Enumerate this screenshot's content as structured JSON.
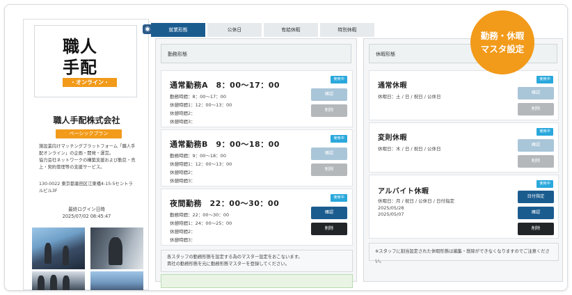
{
  "profile": {
    "logo_line1": "職人",
    "logo_line2": "手配",
    "logo_band": "・オンライン・",
    "company_name": "職人手配株式会社",
    "plan_label": "ベーシックプラン",
    "description": [
      "施設業向けマッチングプラットフォーム「職人手",
      "配オンライン」の企画・開発・運営。",
      "協力会社ネットワークの構築支援および勤怠・売",
      "上・契約管理等の支援サービス。"
    ],
    "address": [
      "130-0022 東京都墨田区江東橋4-15-5セントラ",
      "ルビル3F"
    ],
    "last_login_label": "最終ログイン日時",
    "last_login_value": "2025/07/02 08:45:47",
    "camera_icon": "camera-icon"
  },
  "tabs": [
    {
      "label": "就業形態",
      "active": true
    },
    {
      "label": "公休日",
      "active": false
    },
    {
      "label": "有給休暇",
      "active": false
    },
    {
      "label": "特別休暇",
      "active": false
    }
  ],
  "work_panel": {
    "header": "勤務形態",
    "rows": [
      {
        "title": "通常勤務A　8：00〜17：00",
        "badge": "使用中",
        "lines": [
          "勤務時間：8：00〜17：00",
          "休憩時間1：12：00〜13：00",
          "休憩時間2：",
          "休憩時間3："
        ],
        "confirm": "確認",
        "delete": "削除"
      },
      {
        "title": "通常勤務B　9：00〜18：00",
        "badge": "使用中",
        "lines": [
          "勤務時間：9：00〜18：00",
          "休憩時間1：12：00〜13：00",
          "休憩時間2：",
          "休憩時間3："
        ],
        "confirm": "確認",
        "delete": "削除"
      },
      {
        "title": "夜間勤務　22：00〜30：00",
        "badge": "使用中",
        "lines": [
          "勤務時間：22：00〜30：00",
          "休憩時間1：24：00〜25：00",
          "休憩時間2：",
          "休憩時間3："
        ],
        "confirm": "確認",
        "delete": "削除"
      }
    ],
    "note_lines": [
      "各スタッフの勤務形態を設定する為のマスター設定をおこないます。",
      "貴社の勤務形態を元に勤務形態マスターを登録してください。"
    ]
  },
  "holiday_panel": {
    "header": "休暇形態",
    "rows": [
      {
        "title": "通常休暇",
        "badge": "使用中",
        "lines": [
          "休暇日：土 / 日 / 祝日 / 公休日"
        ],
        "confirm": "確認",
        "delete": "削除"
      },
      {
        "title": "変則休暇",
        "badge": "使用中",
        "lines": [
          "休暇日：木 / 日 / 祝日 / 公休日"
        ],
        "confirm": "確認",
        "delete": "削除"
      },
      {
        "title": "アルバイト休暇",
        "badge": "使用中",
        "lines": [
          "休暇日：月 / 祝日 / 公休日 / 日付指定",
          "2025/05/28",
          "2025/05/07"
        ],
        "date_button": "日付指定",
        "confirm": "確認",
        "delete": "削除"
      }
    ],
    "note": "※スタッフに割当設定された休暇形態は編集・削除ができなくなりますのでご注意ください。"
  },
  "bubble": {
    "line1": "勤務・休暇",
    "line2": "マスタ設定"
  },
  "colors": {
    "accent_blue": "#1b5c8f",
    "orange": "#f29a1a",
    "badge_blue": "#2aa8dc"
  }
}
